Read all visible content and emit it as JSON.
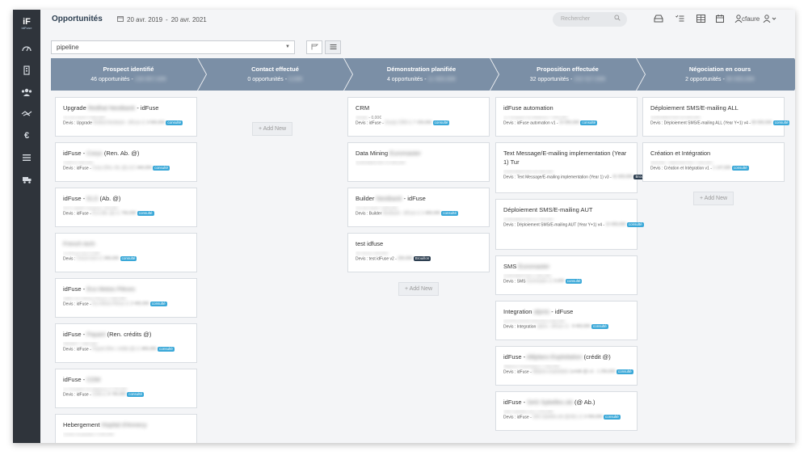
{
  "header": {
    "title": "Opportunités",
    "date_from": "20 avr. 2019",
    "date_sep": "-",
    "date_to": "20 avr. 2021",
    "search_placeholder": "Rechercher",
    "user": "cfaure"
  },
  "toolbar": {
    "pipeline_value": "pipeline"
  },
  "stages": [
    {
      "name": "Prospect identifié",
      "count": "46 opportunités -",
      "amount": "130 857,00€"
    },
    {
      "name": "Contact effectué",
      "count": "0 opportunités -",
      "amount": "0,00€"
    },
    {
      "name": "Démonstration planifiée",
      "count": "4 opportunités -",
      "amount": "11 600,00€"
    },
    {
      "name": "Proposition effectuée",
      "count": "32 opportunités -",
      "amount": "232 527,00€"
    },
    {
      "name": "Négociation en cours",
      "count": "2 opportunités -",
      "amount": "80 000,00€"
    }
  ],
  "add_new_label": "+ Add New",
  "columns": [
    {
      "cards": [
        {
          "title": "Upgrade",
          "title_blur": "Redhat Neotbank",
          "title_end": "- idFuse",
          "line1_blur": "Ca neo bank 3 900,00€",
          "line2_pre": "Devis : Upgrade",
          "line2_blur": "Redhat Neotbank - idFuse v1",
          "line2_amount": "3 500,00€",
          "badge": "consulté",
          "badge_style": "blue"
        },
        {
          "title": "idFuse -",
          "title_blur": "Corys",
          "title_end": "(Ren. Ab. @)",
          "line1_blur": "CORYS 440,00€",
          "line2_pre": "Devis : idFuse -",
          "line2_blur": "Corys (Ren. Ab. @) v2.0",
          "line2_amount": "440,00€",
          "badge": "consulté",
          "badge_style": "blue"
        },
        {
          "title": "idFuse -",
          "title_blur": "KLS",
          "title_end": "(Ab. @)",
          "line1_blur": "KLS Logistic Systems 750,00€",
          "line2_pre": "Devis : idFuse -",
          "line2_blur": "KLS (Ab. @) v1",
          "line2_amount": "750,00€",
          "badge": "consulté",
          "badge_style": "blue"
        },
        {
          "title": "",
          "title_blur": "French tech",
          "title_end": "",
          "line1_blur": "La french tech 0,00€",
          "line2_pre": "Devis :",
          "line2_blur": "French tech v1",
          "line2_amount": "990,00€",
          "badge": "consulté",
          "badge_style": "blue"
        },
        {
          "title": "idFuse -",
          "title_blur": "Eco Motos Pièces",
          "title_end": "",
          "line1_blur": "SARL Eco Motos Pièces 2 400,00€",
          "line2_pre": "Devis : idFuse -",
          "line2_blur": "Eco Motos Pièces v1",
          "line2_amount": "2 400,00€",
          "badge": "consulté",
          "badge_style": "blue"
        },
        {
          "title": "idFuse -",
          "title_blur": "Payant",
          "title_end": "(Ren. crédits @)",
          "line1_blur": "PAYANT 1 080,00€",
          "line2_pre": "Devis : idFuse -",
          "line2_blur": "Payant (Ren. crédits @) v1",
          "line2_amount": "800,00€",
          "badge": "consulté",
          "badge_style": "blue"
        },
        {
          "title": "idFuse -",
          "title_blur": "CDM",
          "title_end": "",
          "line1_blur": "Le Comptoir Du Mattress 9 700,00€",
          "line2_pre": "Devis : idFuse -",
          "line2_blur": "CDM v1",
          "line2_amount": "9 700,00€",
          "badge": "consulté",
          "badge_style": "blue"
        },
        {
          "title": "Hebergement",
          "title_blur": "Hopital d'Annecy",
          "title_end": "",
          "line1_blur": "Centre hospitalier 4 200,00€",
          "line2_pre": "",
          "line2_blur": "",
          "line2_amount": "",
          "badge": "",
          "badge_style": "blue"
        }
      ]
    },
    {
      "cards": []
    },
    {
      "cards": [
        {
          "title": "CRM",
          "title_blur": "",
          "title_end": "",
          "line1_blur": "Sesaly",
          "line1_plain": "- 0,00€",
          "line2_pre": "Devis : idFuse -",
          "line2_blur": "Sesaly CRM v1",
          "line2_amount": "7 200,00€",
          "badge": "consulté",
          "badge_style": "blue"
        },
        {
          "title": "Data Mining",
          "title_blur": "Euromaster",
          "title_end": "",
          "line1_blur": "EUROMASTER 10 000,00€",
          "line2_pre": "",
          "line2_blur": "",
          "line2_amount": "",
          "badge": "",
          "badge_style": "blue"
        },
        {
          "title": "Builder",
          "title_blur": "Neotbank",
          "title_end": "- idFuse",
          "line1_blur": "Ca neo bank 1 800,00€",
          "line2_pre": "Devis : Builder",
          "line2_blur": "Neotbank - idFuse v1",
          "line2_amount": "1 800,00€",
          "badge": "consulté",
          "badge_style": "blue"
        },
        {
          "title": "test idfuse",
          "title_blur": "",
          "title_end": "",
          "line1_blur": "Sk Street 100,00€",
          "line2_pre": "Devis : test idFuse v2 -",
          "line2_blur": "",
          "line2_amount": "200,00€",
          "badge": "Brouillon",
          "badge_style": "dark"
        }
      ]
    },
    {
      "cards": [
        {
          "title": "idFuse automation",
          "title_blur": "",
          "title_end": "",
          "line1_blur": "Le Comptoir Du Mattress 7 000,00€",
          "line2_pre": "Devis : idFuse automation v1 -",
          "line2_blur": "",
          "line2_amount": "10 000,00€",
          "badge": "consulté",
          "badge_style": "blue"
        },
        {
          "title": "Text Message/E-mailing implementation (Year 1) Tur",
          "title_blur": "",
          "title_end": "",
          "line1_blur": "EUROMASTER 30 000,00€",
          "line2_pre": "Devis : Text Message/E-mailing implementation (Year 1) v3 -",
          "line2_blur": "",
          "line2_amount": "41 600,00€",
          "badge": "Brouillon",
          "badge_style": "dark",
          "tall": true
        },
        {
          "title": "Déploiement SMS/E-mailing AUT",
          "title_blur": "",
          "title_end": "",
          "line1_blur": "EUROMASTER 21 750,00€",
          "line2_pre": "Devis : Déploiement SMS/E-mailing AUT (Year Y+1) v4 -",
          "line2_blur": "",
          "line2_amount": "10 000,00€",
          "badge": "consulté",
          "badge_style": "blue",
          "tall": true
        },
        {
          "title": "SMS",
          "title_blur": "Euromaster",
          "title_end": "",
          "line1_blur": "EUROMASTER 2 000,00€",
          "line2_pre": "Devis : SMS",
          "line2_blur": "Euromaster v1",
          "line2_amount": "0,00€",
          "badge": "consulté",
          "badge_style": "blue"
        },
        {
          "title": "Integration",
          "title_blur": "alpnis",
          "title_end": "- idFuse",
          "line1_blur": "ALPPIS ASSOCIATION 8 400,00€",
          "line2_pre": "Devis : Integration",
          "line2_blur": "alpnis - idFuse v1 -",
          "line2_amount": "8 400,00€",
          "badge": "consulté",
          "badge_style": "blue"
        },
        {
          "title": "idFuse -",
          "title_blur": "Alliplans Exploitation",
          "title_end": "(crédit @)",
          "line1_blur": "Alliplans Exploitation 1 250,00€",
          "line2_pre": "Devis : idFuse -",
          "line2_blur": "Alliplans Exploitation",
          "line2_amount": "(crédit @) v1 - 1 250,00€",
          "badge": "consulté",
          "badge_style": "blue"
        },
        {
          "title": "idFuse -",
          "title_blur": "SAS Sybelles.ski",
          "title_end": "(@ Ab.)",
          "line1_blur": "SAS Sybelles.ski 2 475,00€",
          "line2_pre": "Devis : idFuse -",
          "line2_blur": "SAS Sybelles.ski (@ Ab.) v1",
          "line2_amount": "3 550,00€",
          "badge": "consulté",
          "badge_style": "blue"
        }
      ]
    },
    {
      "cards": [
        {
          "title": "Déploiement SMS/E-mailing ALL",
          "title_blur": "",
          "title_end": "",
          "line1_blur": "EUROMASTER 64 000,00€",
          "line2_pre": "Devis : Déploiement SMS/E-mailing ALL (Year Y+1) v4 -",
          "line2_blur": "",
          "line2_amount": "80 000,00€",
          "badge": "consulté",
          "badge_style": "blue"
        },
        {
          "title": "Création et Intégration",
          "title_blur": "",
          "title_end": "",
          "line1_blur": "ADZOM - INNOVATION 1 000,00€",
          "line2_pre": "Devis : Création et Intégration v1 -",
          "line2_blur": "",
          "line2_amount": "1 147,00€",
          "badge": "consulté",
          "badge_style": "blue"
        }
      ]
    }
  ],
  "icons": {
    "sidebar": [
      "dashboard-icon",
      "building-icon",
      "contacts-icon",
      "handshake-icon",
      "euro-icon",
      "list-icon",
      "truck-icon"
    ],
    "header": [
      "inbox-icon",
      "tasks-icon",
      "grid-icon",
      "calendar-icon",
      "person-icon"
    ]
  },
  "colors": {
    "stage": "#7b8fa6",
    "sidebar": "#2f343b",
    "badge": "#3aa8d8",
    "badge_dark": "#2c3e50"
  }
}
